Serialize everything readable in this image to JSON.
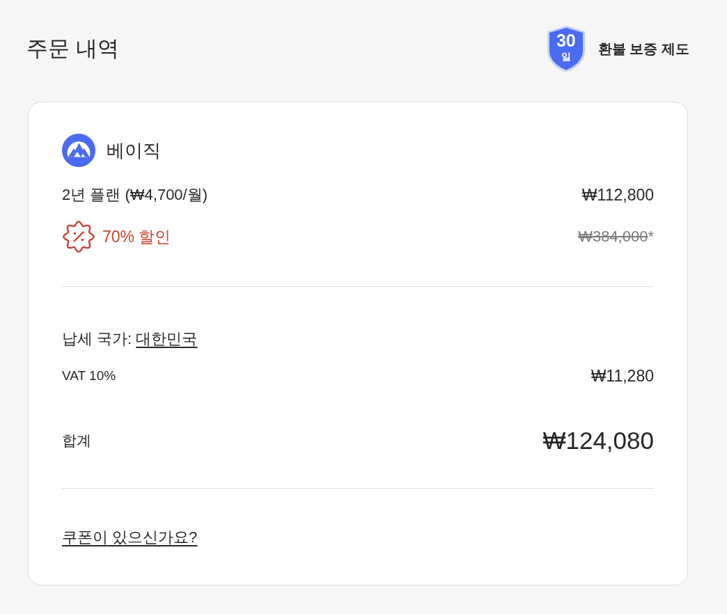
{
  "header": {
    "title": "주문 내역",
    "guarantee": {
      "days": "30",
      "unit": "일",
      "label": "환불 보증 제도"
    }
  },
  "order": {
    "product": {
      "name": "베이직"
    },
    "plan": {
      "label": "2년 플랜 (₩4,700/월)",
      "price": "₩112,800"
    },
    "discount": {
      "label": "70% 할인",
      "original_price": "₩384,000",
      "mark": "*"
    },
    "tax": {
      "label": "납세 국가:",
      "country": "대한민국"
    },
    "vat": {
      "label": "VAT 10%",
      "amount": "₩11,280"
    },
    "total": {
      "label": "합계",
      "amount": "₩124,080"
    },
    "coupon_link": "쿠폰이 있으신가요?"
  }
}
